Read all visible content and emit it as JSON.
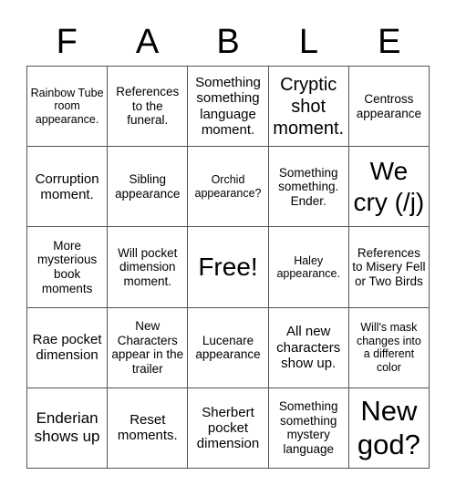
{
  "title_letters": [
    "F",
    "A",
    "B",
    "L",
    "E"
  ],
  "board": {
    "rows": [
      [
        "Rainbow Tube room appearance.",
        "References to the funeral.",
        "Something something language moment.",
        "Cryptic shot moment.",
        "Centross appearance"
      ],
      [
        "Corruption moment.",
        "Sibling appearance",
        "Orchid appearance?",
        "Something something. Ender.",
        "We cry (/j)"
      ],
      [
        "More mysterious book moments",
        "Will pocket dimension moment.",
        "Free!",
        "Haley appearance.",
        "References to Misery Fell or Two Birds"
      ],
      [
        "Rae pocket dimension",
        "New Characters appear in the trailer",
        "Lucenare appearance",
        "All new characters show up.",
        "Will's mask changes into a different color"
      ],
      [
        "Enderian shows up",
        "Reset moments.",
        "Sherbert pocket dimension",
        "Something something mystery language",
        "New god?"
      ]
    ],
    "free_space": {
      "row": 2,
      "col": 2
    }
  },
  "colors": {
    "grid_line": "#555555",
    "text": "#000000",
    "background": "#ffffff"
  }
}
